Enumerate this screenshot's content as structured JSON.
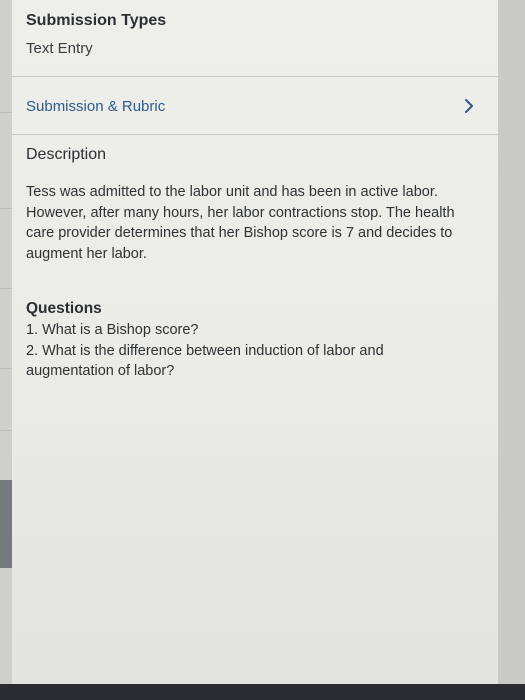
{
  "submission": {
    "types_label": "Submission Types",
    "types_value": "Text Entry"
  },
  "rubric_row": {
    "label": "Submission & Rubric",
    "icon": "chevron-right-icon",
    "accent": "#2b5a8e"
  },
  "description": {
    "title": "Description",
    "body": "Tess was admitted to the labor unit and has been in active labor. However, after many hours, her labor contractions stop. The health care provider determines that her Bishop score is 7 and decides to augment her labor."
  },
  "questions": {
    "title": "Questions",
    "items": [
      "1. What is a Bishop score?",
      "2. What is the difference between induction of labor and augmentation of labor?"
    ]
  }
}
